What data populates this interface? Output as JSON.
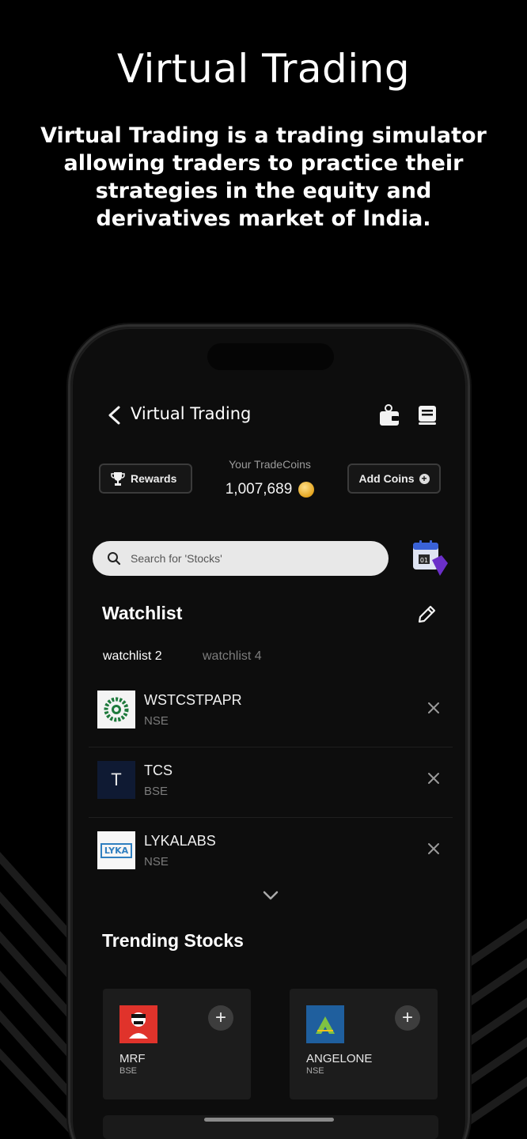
{
  "promo": {
    "title": "Virtual Trading",
    "subtitle": "Virtual Trading is a trading simulator allowing traders to practice their strategies in the equity and derivatives market of India."
  },
  "header": {
    "title": "Virtual Trading",
    "icons": [
      "back-arrow-icon",
      "wallet-icon",
      "book-icon"
    ]
  },
  "coins": {
    "rewards_label": "Rewards",
    "label": "Your TradeCoins",
    "value": "1,007,689",
    "add_label": "Add Coins",
    "coin_color": "#e4a520"
  },
  "search": {
    "placeholder": "Search for 'Stocks'"
  },
  "watchlist": {
    "title": "Watchlist",
    "tabs": [
      {
        "label": "watchlist 2",
        "active": true
      },
      {
        "label": "watchlist 4",
        "active": false
      }
    ],
    "items": [
      {
        "symbol": "WSTCSTPAPR",
        "exchange": "NSE"
      },
      {
        "symbol": "TCS",
        "exchange": "BSE",
        "logo_letter": "T"
      },
      {
        "symbol": "LYKALABS",
        "exchange": "NSE",
        "logo_text": "LYKA"
      }
    ]
  },
  "trending": {
    "title": "Trending Stocks",
    "cards": [
      {
        "symbol": "MRF",
        "exchange": "BSE",
        "logo_color": "#e0332b"
      },
      {
        "symbol": "ANGELONE",
        "exchange": "NSE",
        "logo_color": "#1f5f9e"
      }
    ]
  },
  "colors": {
    "background": "#000000",
    "screen": "#0d0d0d",
    "card": "#1c1c1c",
    "search_bg": "#e8e8e8"
  }
}
